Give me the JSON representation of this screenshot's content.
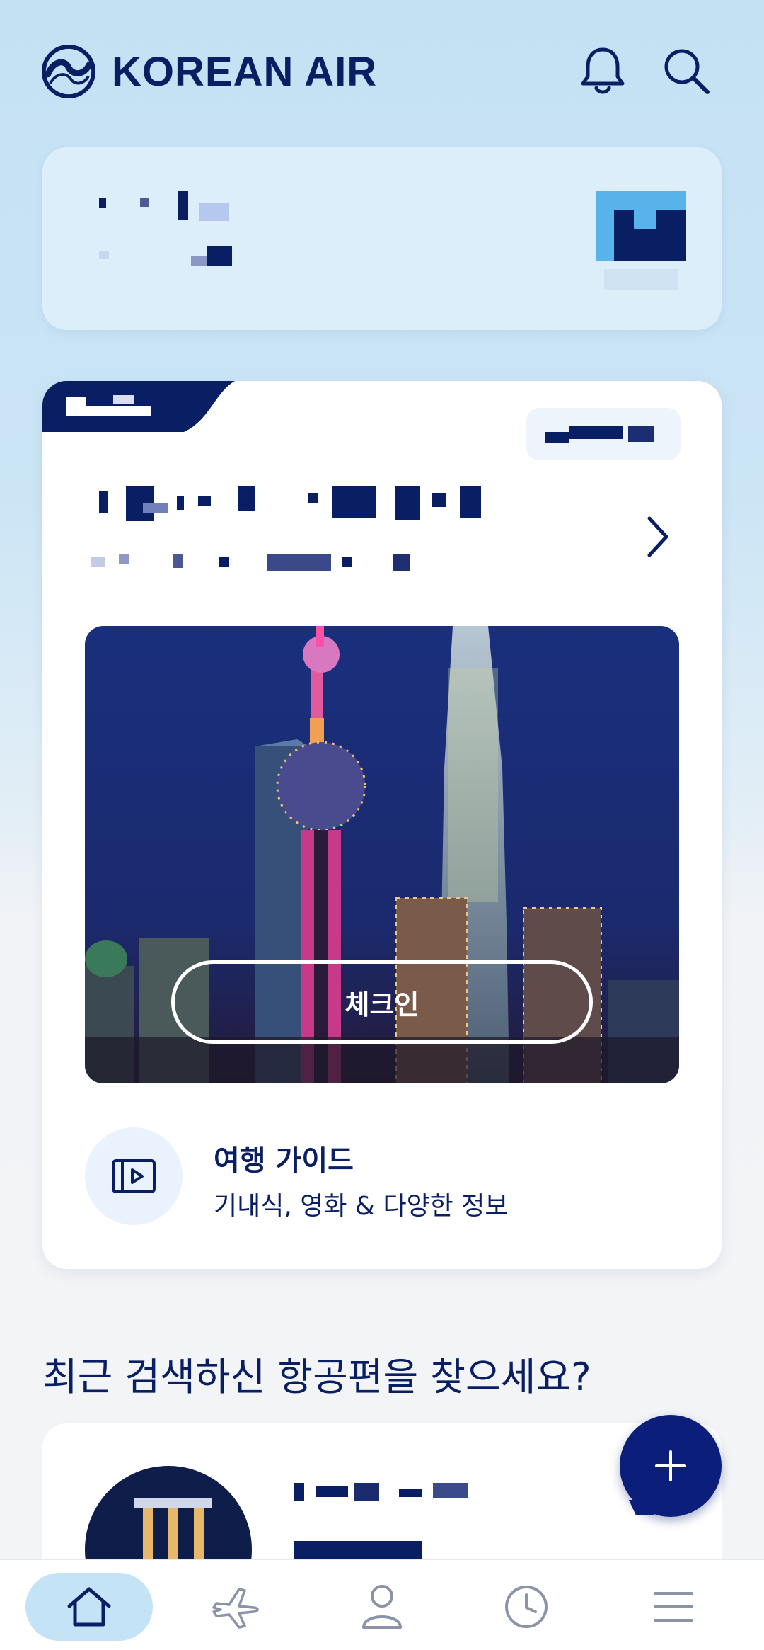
{
  "header": {
    "brand": "KOREAN AIR",
    "icons": [
      "bell-icon",
      "search-icon"
    ]
  },
  "trip_card": {
    "checkin_label": "체크인",
    "guide": {
      "title": "여행 가이드",
      "subtitle": "기내식, 영화 & 다양한 정보"
    }
  },
  "recent": {
    "title": "최근 검색하신 항공편을 찾으세요?"
  },
  "fab": {
    "icon": "plus-icon"
  },
  "bottom_nav": {
    "items": [
      "home-icon",
      "flight-icon",
      "profile-icon",
      "history-icon",
      "menu-icon"
    ],
    "active": "home-icon"
  },
  "colors": {
    "brand_navy": "#0a1f63",
    "fab_blue": "#0b1e7a",
    "sky_bg": "#c4e1f4",
    "card_light": "#dbeef9",
    "nav_active": "#c4e3f6"
  }
}
